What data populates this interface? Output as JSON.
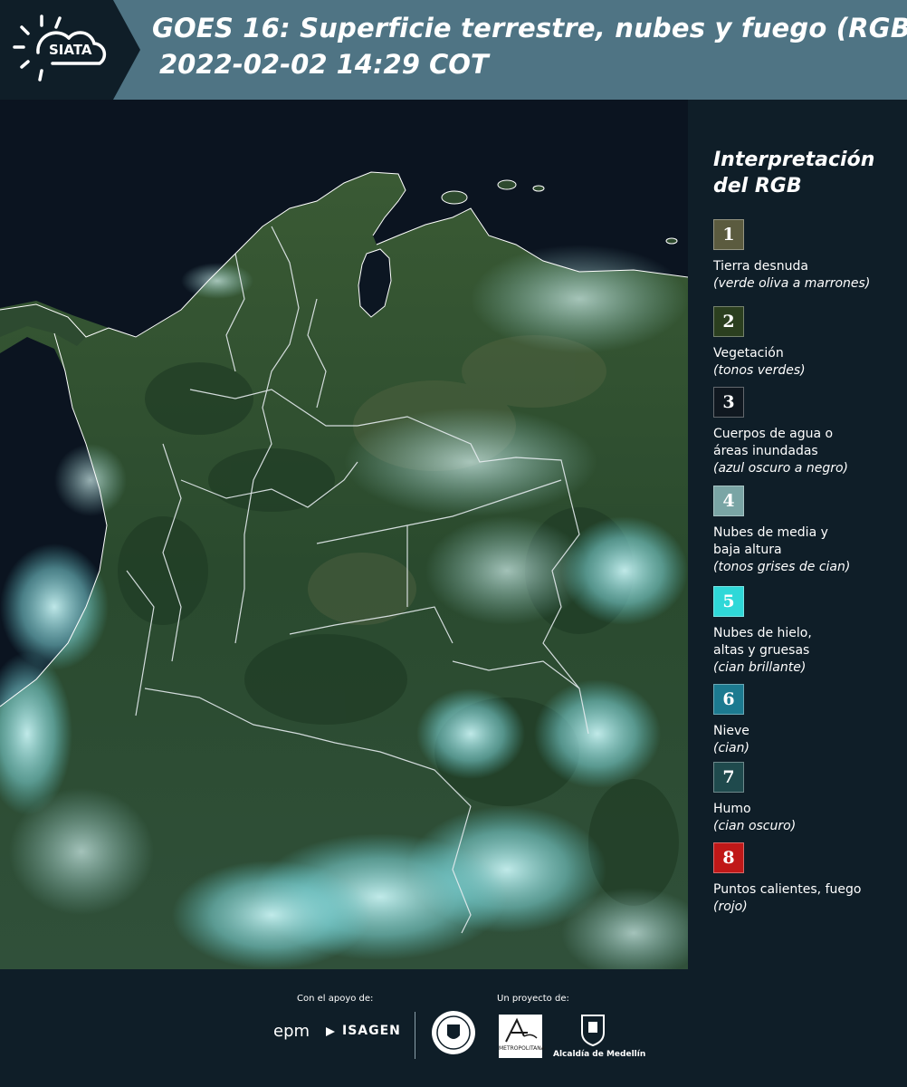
{
  "header": {
    "logo_text": "SIATA",
    "title": "GOES 16: Superficie terrestre, nubes y fuego (RGB)",
    "datetime": "2022-02-02 14:29 COT"
  },
  "legend": {
    "title_line1": "Interpretación",
    "title_line2": "del RGB",
    "items": [
      {
        "number": "1",
        "color": "#5b5b3f",
        "label": "Tierra desnuda",
        "sub": "(verde oliva a marrones)"
      },
      {
        "number": "2",
        "color": "#2b3f1f",
        "label": "Vegetación",
        "sub": "(tonos verdes)"
      },
      {
        "number": "3",
        "color": "#101820",
        "label": "Cuerpos de agua o áreas inundadas",
        "sub": "(azul oscuro a negro)"
      },
      {
        "number": "4",
        "color": "#7aa5a5",
        "label": "Nubes de media y baja altura",
        "sub": "(tonos grises de cian)"
      },
      {
        "number": "5",
        "color": "#2fd8d8",
        "label": "Nubes de hielo, altas y gruesas",
        "sub": "(cian brillante)"
      },
      {
        "number": "6",
        "color": "#1c7a90",
        "label": "Nieve",
        "sub": "(cian)"
      },
      {
        "number": "7",
        "color": "#1f4a4d",
        "label": "Humo",
        "sub": "(cian oscuro)"
      },
      {
        "number": "8",
        "color": "#c01818",
        "label": "Puntos calientes, fuego",
        "sub": "(rojo)"
      }
    ]
  },
  "footer": {
    "support_label": "Con el apoyo de:",
    "project_label": "Un proyecto de:",
    "epm": "epm",
    "isagen": "ISAGEN",
    "area_text": "METROPOLITANA",
    "alcaldia": "Alcaldía de Medellín"
  }
}
